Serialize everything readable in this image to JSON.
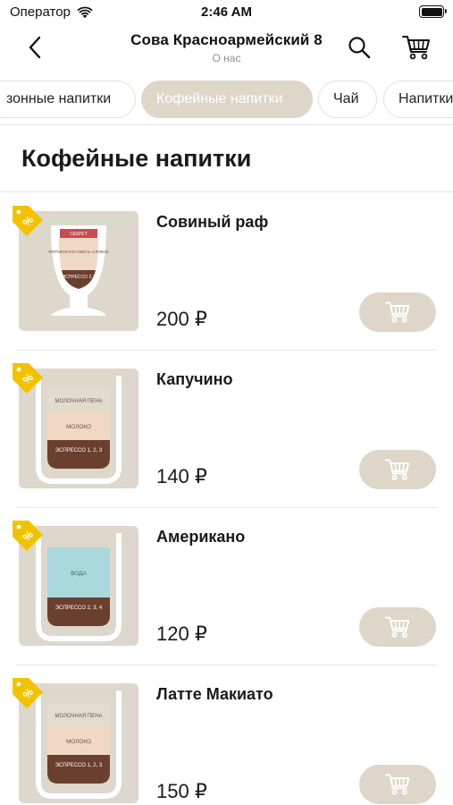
{
  "status_bar": {
    "carrier": "Оператор",
    "time": "2:46 AM"
  },
  "nav": {
    "title": "Сова Красноармейский 8",
    "subtitle": "О нас"
  },
  "categories": [
    {
      "label": "зонные напитки",
      "active": false
    },
    {
      "label": "Кофейные напитки",
      "active": true
    },
    {
      "label": "Чай",
      "active": false
    },
    {
      "label": "Напитки",
      "active": false
    }
  ],
  "section": {
    "title": "Кофейные напитки"
  },
  "products": [
    {
      "name": "Совиный раф",
      "price": "200 ₽",
      "image": {
        "kind": "glass",
        "layers": [
          "СЕКРЕТ",
          "ФИРМЕННАЯ СМЕСЬ СЛИВОК",
          "ЭСПРЕССО 2,3"
        ]
      }
    },
    {
      "name": "Капучино",
      "price": "140 ₽",
      "image": {
        "kind": "cup",
        "layers": [
          "МОЛОЧНАЯ ПЕНА",
          "МОЛОКО",
          "ЭСПРЕССО 1, 2, 3"
        ]
      }
    },
    {
      "name": "Американо",
      "price": "120 ₽",
      "image": {
        "kind": "cup",
        "layers": [
          "ВОДА",
          "ЭСПРЕССО 2, 3, 4"
        ]
      }
    },
    {
      "name": "Латте Макиато",
      "price": "150 ₽",
      "image": {
        "kind": "cup",
        "layers": [
          "МОЛОЧНАЯ ПЕНА",
          "МОЛОКО",
          "ЭСПРЕССО 1, 2, 3"
        ]
      }
    }
  ],
  "icons": {
    "back": "chevron-left-icon",
    "search": "search-icon",
    "cart": "cart-icon",
    "discount": "percent-tag-icon",
    "add_to_cart": "cart-icon"
  },
  "colors": {
    "accent": "#ddd6c9",
    "tag": "#f2c200",
    "foam": "#e2dccf",
    "milk": "#efd9c4",
    "espresso": "#6b3f2e",
    "water": "#a9d9dd",
    "secret": "#c94a4f"
  }
}
